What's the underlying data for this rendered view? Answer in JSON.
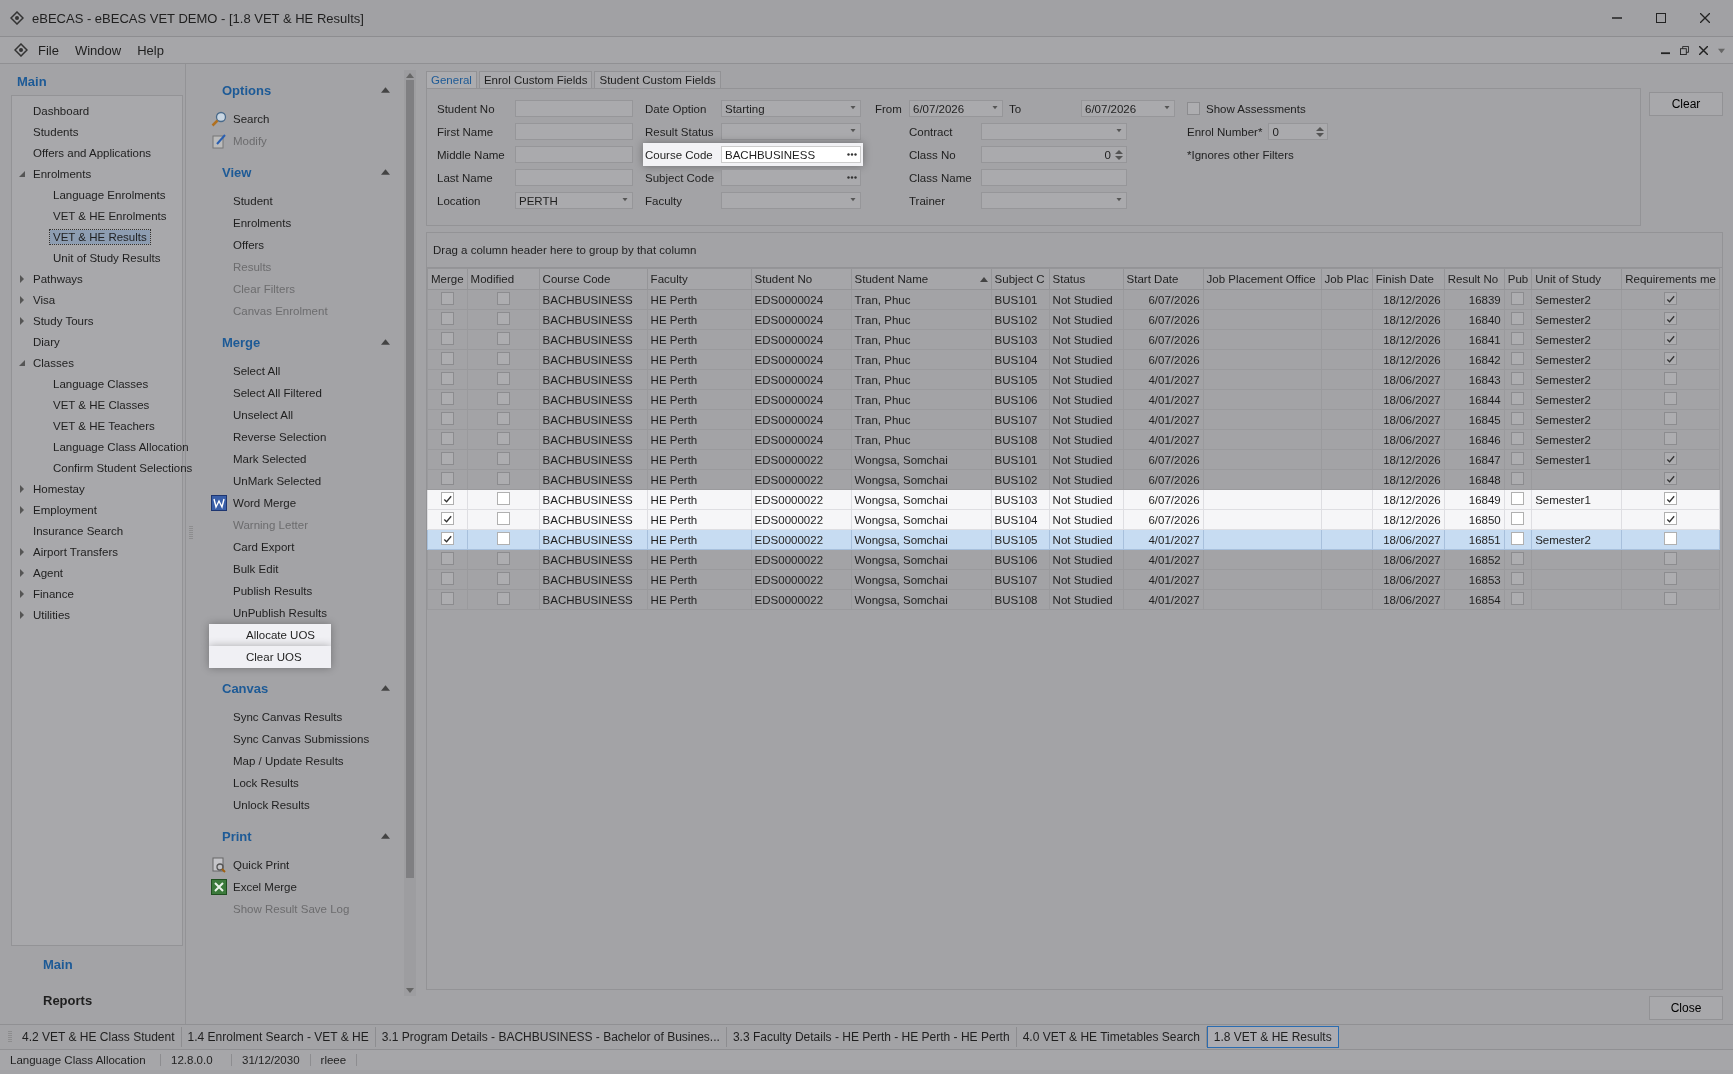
{
  "window": {
    "title": "eBECAS - eBECAS VET DEMO - [1.8 VET & HE Results]",
    "menu": [
      "File",
      "Window",
      "Help"
    ]
  },
  "nav": {
    "title": "Main",
    "tree": [
      {
        "label": "Dashboard",
        "selected": false
      },
      {
        "label": "Students",
        "selected": false
      },
      {
        "label": "Offers and Applications",
        "selected": false
      },
      {
        "label": "Enrolments",
        "selected": false,
        "expanded": true,
        "children": [
          {
            "label": "Language Enrolments",
            "selected": false
          },
          {
            "label": "VET & HE Enrolments",
            "selected": false
          },
          {
            "label": "VET & HE Results",
            "selected": true
          },
          {
            "label": "Unit of Study Results",
            "selected": false
          }
        ]
      },
      {
        "label": "Pathways",
        "selected": false,
        "expanded": false
      },
      {
        "label": "Visa",
        "selected": false,
        "expanded": false
      },
      {
        "label": "Study Tours",
        "selected": false,
        "expanded": false
      },
      {
        "label": "Diary",
        "selected": false
      },
      {
        "label": "Classes",
        "selected": false,
        "expanded": true,
        "children": [
          {
            "label": "Language Classes",
            "selected": false
          },
          {
            "label": "VET & HE Classes",
            "selected": false
          },
          {
            "label": "VET & HE Teachers",
            "selected": false
          },
          {
            "label": "Language Class Allocation",
            "selected": false
          },
          {
            "label": "Confirm Student Selections",
            "selected": false
          }
        ]
      },
      {
        "label": "Homestay",
        "selected": false,
        "expanded": false
      },
      {
        "label": "Employment",
        "selected": false,
        "expanded": false
      },
      {
        "label": "Insurance Search",
        "selected": false
      },
      {
        "label": "Airport Transfers",
        "selected": false,
        "expanded": false
      },
      {
        "label": "Agent",
        "selected": false,
        "expanded": false
      },
      {
        "label": "Finance",
        "selected": false,
        "expanded": false
      },
      {
        "label": "Utilities",
        "selected": false,
        "expanded": false
      }
    ],
    "panes": [
      {
        "label": "Main",
        "selected": true
      },
      {
        "label": "Reports",
        "selected": false
      }
    ]
  },
  "action_groups": [
    {
      "title": "Options",
      "expanded": true,
      "items": [
        {
          "label": "Search",
          "kind": "search",
          "disabled": false,
          "highlighted": false
        },
        {
          "label": "Modify",
          "kind": "modify",
          "disabled": true,
          "highlighted": false
        }
      ]
    },
    {
      "title": "View",
      "expanded": true,
      "items": [
        {
          "label": "Student",
          "kind": "plain",
          "disabled": false,
          "highlighted": false
        },
        {
          "label": "Enrolments",
          "kind": "plain",
          "disabled": false,
          "highlighted": false
        },
        {
          "label": "Offers",
          "kind": "plain",
          "disabled": false,
          "highlighted": false
        },
        {
          "label": "Results",
          "kind": "plain",
          "disabled": true,
          "highlighted": false
        },
        {
          "label": "Clear Filters",
          "kind": "plain",
          "disabled": true,
          "highlighted": false
        },
        {
          "label": "Canvas Enrolment",
          "kind": "plain",
          "disabled": true,
          "highlighted": false
        }
      ]
    },
    {
      "title": "Merge",
      "expanded": true,
      "items": [
        {
          "label": "Select All",
          "kind": "plain",
          "disabled": false,
          "highlighted": false
        },
        {
          "label": "Select All Filtered",
          "kind": "plain",
          "disabled": false,
          "highlighted": false
        },
        {
          "label": "Unselect All",
          "kind": "plain",
          "disabled": false,
          "highlighted": false
        },
        {
          "label": "Reverse Selection",
          "kind": "plain",
          "disabled": false,
          "highlighted": false
        },
        {
          "label": "Mark Selected",
          "kind": "plain",
          "disabled": false,
          "highlighted": false
        },
        {
          "label": "UnMark Selected",
          "kind": "plain",
          "disabled": false,
          "highlighted": false
        },
        {
          "label": "Word Merge",
          "kind": "word",
          "disabled": false,
          "highlighted": false
        },
        {
          "label": "Warning Letter",
          "kind": "plain",
          "disabled": true,
          "highlighted": false
        },
        {
          "label": "Card Export",
          "kind": "plain",
          "disabled": false,
          "highlighted": false
        },
        {
          "label": "Bulk Edit",
          "kind": "plain",
          "disabled": false,
          "highlighted": false
        },
        {
          "label": "Publish Results",
          "kind": "plain",
          "disabled": false,
          "highlighted": false
        },
        {
          "label": "UnPublish Results",
          "kind": "plain",
          "disabled": false,
          "highlighted": false
        },
        {
          "label": "Allocate UOS",
          "kind": "plain",
          "disabled": false,
          "highlighted": true
        },
        {
          "label": "Clear UOS",
          "kind": "plain",
          "disabled": false,
          "highlighted": true
        }
      ]
    },
    {
      "title": "Canvas",
      "expanded": true,
      "items": [
        {
          "label": "Sync Canvas Results",
          "kind": "plain",
          "disabled": false,
          "highlighted": false
        },
        {
          "label": "Sync Canvas Submissions",
          "kind": "plain",
          "disabled": false,
          "highlighted": false
        },
        {
          "label": "Map / Update Results",
          "kind": "plain",
          "disabled": false,
          "highlighted": false
        },
        {
          "label": "Lock Results",
          "kind": "plain",
          "disabled": false,
          "highlighted": false
        },
        {
          "label": "Unlock Results",
          "kind": "plain",
          "disabled": false,
          "highlighted": false
        }
      ]
    },
    {
      "title": "Print",
      "expanded": true,
      "items": [
        {
          "label": "Quick Print",
          "kind": "print",
          "disabled": false,
          "highlighted": false
        },
        {
          "label": "Excel Merge",
          "kind": "excel",
          "disabled": false,
          "highlighted": false
        },
        {
          "label": "Show Result Save Log",
          "kind": "plain",
          "disabled": true,
          "highlighted": false
        }
      ]
    }
  ],
  "tabs": [
    {
      "label": "General",
      "selected": true
    },
    {
      "label": "Enrol Custom Fields",
      "selected": false
    },
    {
      "label": "Student Custom Fields",
      "selected": false
    }
  ],
  "filters": {
    "groups": [
      [
        {
          "kind": "text",
          "label": "Student No",
          "highlighted": false
        },
        {
          "kind": "text",
          "label": "First Name",
          "highlighted": false
        },
        {
          "kind": "text",
          "label": "Middle Name",
          "highlighted": false
        },
        {
          "kind": "text",
          "label": "Last Name",
          "highlighted": false
        },
        {
          "kind": "dropdown",
          "label": "Location",
          "value": "PERTH",
          "highlighted": false
        }
      ],
      [
        {
          "kind": "dropdown",
          "label": "Date Option",
          "value": "Starting",
          "highlighted": false
        },
        {
          "kind": "dropdown",
          "label": "Result Status",
          "highlighted": false
        },
        {
          "kind": "browse",
          "label": "Course Code",
          "value": "BACHBUSINESS",
          "highlighted": true
        },
        {
          "kind": "browse",
          "label": "Subject Code",
          "highlighted": false
        },
        {
          "kind": "dropdown",
          "label": "Faculty",
          "highlighted": false
        }
      ],
      [
        {
          "kind": "range",
          "label": "From",
          "value": "6/07/2026",
          "to_label": "To",
          "to_value": "6/07/2026",
          "highlighted": false
        },
        {
          "kind": "dropdown",
          "label": "Contract",
          "highlighted": false
        },
        {
          "kind": "spin",
          "label": "Class No",
          "value": "0",
          "highlighted": false
        },
        {
          "kind": "text",
          "label": "Class Name",
          "highlighted": false
        },
        {
          "kind": "dropdown",
          "label": "Trainer",
          "highlighted": false
        }
      ],
      [
        {
          "kind": "checkbox",
          "label": "Show Assessments",
          "checked": false,
          "highlighted": false
        },
        {
          "kind": "spin",
          "label": "Enrol Number*",
          "value": "0",
          "highlighted": false
        },
        {
          "kind": "note",
          "label": "*Ignores other Filters",
          "highlighted": false
        }
      ]
    ]
  },
  "clear_button": "Clear",
  "grid": {
    "group_hint": "Drag a column header here to group by that column",
    "columns": [
      {
        "label": "Merge"
      },
      {
        "label": "Modified"
      },
      {
        "label": "Course Code"
      },
      {
        "label": "Faculty"
      },
      {
        "label": "Student No"
      },
      {
        "label": "Student Name",
        "sort_ascending": true
      },
      {
        "label": "Subject C"
      },
      {
        "label": "Status"
      },
      {
        "label": "Start Date"
      },
      {
        "label": "Job Placement Office"
      },
      {
        "label": "Job Plac"
      },
      {
        "label": "Finish Date"
      },
      {
        "label": "Result No"
      },
      {
        "label": "Pub"
      },
      {
        "label": "Unit of Study"
      },
      {
        "label": "Requirements me"
      }
    ],
    "rows": [
      {
        "merge": false,
        "modified": false,
        "course_code": "BACHBUSINESS",
        "faculty": "HE Perth",
        "student_no": "EDS0000024",
        "student_name": "Tran, Phuc",
        "subject_code": "BUS101",
        "status": "Not Studied",
        "start_date": "6/07/2026",
        "finish_date": "18/12/2026",
        "result_no": "16839",
        "pub": false,
        "unit_of_study": "Semester2",
        "requirements_met": true,
        "highlighted": false,
        "selected": false
      },
      {
        "merge": false,
        "modified": false,
        "course_code": "BACHBUSINESS",
        "faculty": "HE Perth",
        "student_no": "EDS0000024",
        "student_name": "Tran, Phuc",
        "subject_code": "BUS102",
        "status": "Not Studied",
        "start_date": "6/07/2026",
        "finish_date": "18/12/2026",
        "result_no": "16840",
        "pub": false,
        "unit_of_study": "Semester2",
        "requirements_met": true,
        "highlighted": false,
        "selected": false
      },
      {
        "merge": false,
        "modified": false,
        "course_code": "BACHBUSINESS",
        "faculty": "HE Perth",
        "student_no": "EDS0000024",
        "student_name": "Tran, Phuc",
        "subject_code": "BUS103",
        "status": "Not Studied",
        "start_date": "6/07/2026",
        "finish_date": "18/12/2026",
        "result_no": "16841",
        "pub": false,
        "unit_of_study": "Semester2",
        "requirements_met": true,
        "highlighted": false,
        "selected": false
      },
      {
        "merge": false,
        "modified": false,
        "course_code": "BACHBUSINESS",
        "faculty": "HE Perth",
        "student_no": "EDS0000024",
        "student_name": "Tran, Phuc",
        "subject_code": "BUS104",
        "status": "Not Studied",
        "start_date": "6/07/2026",
        "finish_date": "18/12/2026",
        "result_no": "16842",
        "pub": false,
        "unit_of_study": "Semester2",
        "requirements_met": true,
        "highlighted": false,
        "selected": false
      },
      {
        "merge": false,
        "modified": false,
        "course_code": "BACHBUSINESS",
        "faculty": "HE Perth",
        "student_no": "EDS0000024",
        "student_name": "Tran, Phuc",
        "subject_code": "BUS105",
        "status": "Not Studied",
        "start_date": "4/01/2027",
        "finish_date": "18/06/2027",
        "result_no": "16843",
        "pub": false,
        "unit_of_study": "Semester2",
        "requirements_met": false,
        "highlighted": false,
        "selected": false
      },
      {
        "merge": false,
        "modified": false,
        "course_code": "BACHBUSINESS",
        "faculty": "HE Perth",
        "student_no": "EDS0000024",
        "student_name": "Tran, Phuc",
        "subject_code": "BUS106",
        "status": "Not Studied",
        "start_date": "4/01/2027",
        "finish_date": "18/06/2027",
        "result_no": "16844",
        "pub": false,
        "unit_of_study": "Semester2",
        "requirements_met": false,
        "highlighted": false,
        "selected": false
      },
      {
        "merge": false,
        "modified": false,
        "course_code": "BACHBUSINESS",
        "faculty": "HE Perth",
        "student_no": "EDS0000024",
        "student_name": "Tran, Phuc",
        "subject_code": "BUS107",
        "status": "Not Studied",
        "start_date": "4/01/2027",
        "finish_date": "18/06/2027",
        "result_no": "16845",
        "pub": false,
        "unit_of_study": "Semester2",
        "requirements_met": false,
        "highlighted": false,
        "selected": false
      },
      {
        "merge": false,
        "modified": false,
        "course_code": "BACHBUSINESS",
        "faculty": "HE Perth",
        "student_no": "EDS0000024",
        "student_name": "Tran, Phuc",
        "subject_code": "BUS108",
        "status": "Not Studied",
        "start_date": "4/01/2027",
        "finish_date": "18/06/2027",
        "result_no": "16846",
        "pub": false,
        "unit_of_study": "Semester2",
        "requirements_met": false,
        "highlighted": false,
        "selected": false
      },
      {
        "merge": false,
        "modified": false,
        "course_code": "BACHBUSINESS",
        "faculty": "HE Perth",
        "student_no": "EDS0000022",
        "student_name": "Wongsa, Somchai",
        "subject_code": "BUS101",
        "status": "Not Studied",
        "start_date": "6/07/2026",
        "finish_date": "18/12/2026",
        "result_no": "16847",
        "pub": false,
        "unit_of_study": "Semester1",
        "requirements_met": true,
        "highlighted": false,
        "selected": false
      },
      {
        "merge": false,
        "modified": false,
        "course_code": "BACHBUSINESS",
        "faculty": "HE Perth",
        "student_no": "EDS0000022",
        "student_name": "Wongsa, Somchai",
        "subject_code": "BUS102",
        "status": "Not Studied",
        "start_date": "6/07/2026",
        "finish_date": "18/12/2026",
        "result_no": "16848",
        "pub": false,
        "requirements_met": true,
        "highlighted": false,
        "selected": false
      },
      {
        "merge": true,
        "modified": false,
        "course_code": "BACHBUSINESS",
        "faculty": "HE Perth",
        "student_no": "EDS0000022",
        "student_name": "Wongsa, Somchai",
        "subject_code": "BUS103",
        "status": "Not Studied",
        "start_date": "6/07/2026",
        "finish_date": "18/12/2026",
        "result_no": "16849",
        "pub": false,
        "unit_of_study": "Semester1",
        "requirements_met": true,
        "highlighted": true,
        "selected": false
      },
      {
        "merge": true,
        "modified": false,
        "course_code": "BACHBUSINESS",
        "faculty": "HE Perth",
        "student_no": "EDS0000022",
        "student_name": "Wongsa, Somchai",
        "subject_code": "BUS104",
        "status": "Not Studied",
        "start_date": "6/07/2026",
        "finish_date": "18/12/2026",
        "result_no": "16850",
        "pub": false,
        "requirements_met": true,
        "highlighted": true,
        "selected": false
      },
      {
        "merge": true,
        "modified": false,
        "course_code": "BACHBUSINESS",
        "faculty": "HE Perth",
        "student_no": "EDS0000022",
        "student_name": "Wongsa, Somchai",
        "subject_code": "BUS105",
        "status": "Not Studied",
        "start_date": "4/01/2027",
        "finish_date": "18/06/2027",
        "result_no": "16851",
        "pub": false,
        "unit_of_study": "Semester2",
        "requirements_met": false,
        "highlighted": true,
        "selected": true
      },
      {
        "merge": false,
        "modified": false,
        "course_code": "BACHBUSINESS",
        "faculty": "HE Perth",
        "student_no": "EDS0000022",
        "student_name": "Wongsa, Somchai",
        "subject_code": "BUS106",
        "status": "Not Studied",
        "start_date": "4/01/2027",
        "finish_date": "18/06/2027",
        "result_no": "16852",
        "pub": false,
        "requirements_met": false,
        "highlighted": false,
        "selected": false
      },
      {
        "merge": false,
        "modified": false,
        "course_code": "BACHBUSINESS",
        "faculty": "HE Perth",
        "student_no": "EDS0000022",
        "student_name": "Wongsa, Somchai",
        "subject_code": "BUS107",
        "status": "Not Studied",
        "start_date": "4/01/2027",
        "finish_date": "18/06/2027",
        "result_no": "16853",
        "pub": false,
        "requirements_met": false,
        "highlighted": false,
        "selected": false
      },
      {
        "merge": false,
        "modified": false,
        "course_code": "BACHBUSINESS",
        "faculty": "HE Perth",
        "student_no": "EDS0000022",
        "student_name": "Wongsa, Somchai",
        "subject_code": "BUS108",
        "status": "Not Studied",
        "start_date": "4/01/2027",
        "finish_date": "18/06/2027",
        "result_no": "16854",
        "pub": false,
        "requirements_met": false,
        "highlighted": false,
        "selected": false
      }
    ]
  },
  "close_button": "Close",
  "document_tabs": [
    {
      "label": "4.2 VET & HE Class Student",
      "selected": false
    },
    {
      "label": "1.4 Enrolment Search - VET & HE",
      "selected": false
    },
    {
      "label": "3.1 Program Details - BACHBUSINESS -  Bachelor of Busines...",
      "selected": false
    },
    {
      "label": "3.3 Faculty Details - HE Perth - HE Perth - HE Perth",
      "selected": false
    },
    {
      "label": "4.0 VET & HE Timetables Search",
      "selected": false
    },
    {
      "label": "1.8 VET & HE Results",
      "selected": true
    }
  ],
  "status_bar": [
    "Language Class Allocation",
    "12.8.0.0",
    "31/12/2030",
    "rleee"
  ]
}
